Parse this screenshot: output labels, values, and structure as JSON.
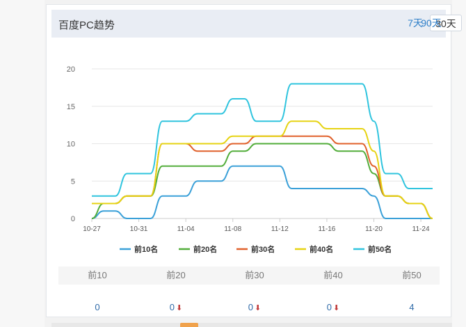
{
  "panel": {
    "title": "百度PC趋势"
  },
  "range_tabs": [
    {
      "label": "7天",
      "active": false
    },
    {
      "label": "30天",
      "active": true
    },
    {
      "label": "90天",
      "active": false
    }
  ],
  "stats": {
    "columns": [
      {
        "label": "前10",
        "value": "0",
        "trend": ""
      },
      {
        "label": "前20",
        "value": "0",
        "trend": "down"
      },
      {
        "label": "前30",
        "value": "0",
        "trend": "down"
      },
      {
        "label": "前40",
        "value": "0",
        "trend": "down"
      },
      {
        "label": "前50",
        "value": "4",
        "trend": ""
      }
    ],
    "down_arrow": "⬇"
  },
  "chart_data": {
    "type": "line",
    "x": [
      "10-27",
      "10-28",
      "10-29",
      "10-30",
      "10-31",
      "11-01",
      "11-02",
      "11-03",
      "11-04",
      "11-05",
      "11-06",
      "11-07",
      "11-08",
      "11-09",
      "11-10",
      "11-11",
      "11-12",
      "11-13",
      "11-14",
      "11-15",
      "11-16",
      "11-17",
      "11-18",
      "11-19",
      "11-20",
      "11-21",
      "11-22",
      "11-23",
      "11-24",
      "11-25"
    ],
    "x_ticks": [
      "10-27",
      "10-31",
      "11-04",
      "11-08",
      "11-12",
      "11-16",
      "11-20",
      "11-24"
    ],
    "ylim": [
      0,
      20
    ],
    "y_ticks": [
      0,
      5,
      10,
      15,
      20
    ],
    "grid": true,
    "legend_position": "bottom",
    "series": [
      {
        "name": "前10名",
        "color": "#3aa0d8",
        "values": [
          0,
          1,
          1,
          0,
          0,
          0,
          3,
          3,
          3,
          5,
          5,
          5,
          7,
          7,
          7,
          7,
          7,
          4,
          4,
          4,
          4,
          4,
          4,
          4,
          3,
          0,
          0,
          0,
          0,
          0
        ]
      },
      {
        "name": "前20名",
        "color": "#52ad3a",
        "values": [
          0,
          2,
          2,
          3,
          3,
          3,
          7,
          7,
          7,
          7,
          7,
          7,
          9,
          9,
          10,
          10,
          10,
          10,
          10,
          10,
          10,
          9,
          9,
          9,
          6,
          3,
          3,
          2,
          2,
          0
        ]
      },
      {
        "name": "前30名",
        "color": "#e0602a",
        "values": [
          2,
          2,
          2,
          3,
          3,
          3,
          10,
          10,
          10,
          9,
          9,
          9,
          10,
          10,
          11,
          11,
          11,
          11,
          11,
          11,
          11,
          10,
          10,
          10,
          7,
          3,
          3,
          2,
          2,
          0
        ]
      },
      {
        "name": "前40名",
        "color": "#e6d312",
        "values": [
          2,
          2,
          2,
          3,
          3,
          3,
          10,
          10,
          10,
          10,
          10,
          10,
          11,
          11,
          11,
          11,
          11,
          13,
          13,
          13,
          12,
          12,
          12,
          12,
          9,
          3,
          3,
          2,
          2,
          0
        ]
      },
      {
        "name": "前50名",
        "color": "#2fc4de",
        "values": [
          3,
          3,
          3,
          6,
          6,
          6,
          13,
          13,
          13,
          14,
          14,
          14,
          16,
          16,
          13,
          13,
          13,
          18,
          18,
          18,
          18,
          18,
          18,
          18,
          13,
          6,
          6,
          4,
          4,
          4
        ]
      }
    ]
  }
}
